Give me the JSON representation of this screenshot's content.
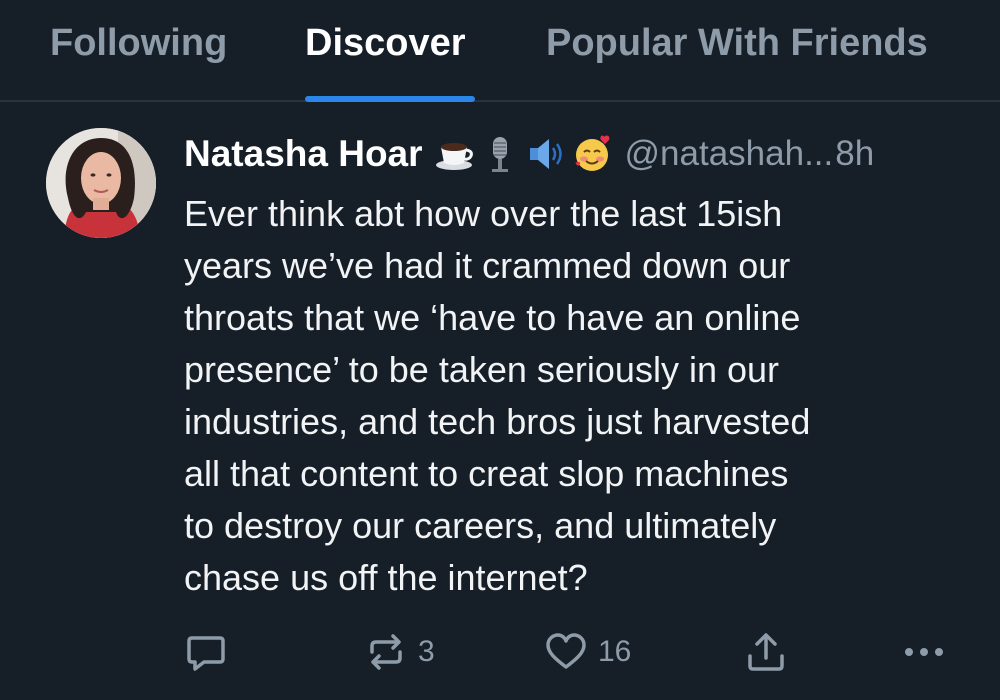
{
  "tabs": [
    {
      "label": "Following",
      "active": false
    },
    {
      "label": "Discover",
      "active": true
    },
    {
      "label": "Popular With Friends",
      "active": false
    }
  ],
  "accent_color": "#2a86e8",
  "post": {
    "author": {
      "name": "Natasha Hoar",
      "name_emojis": [
        "coffee-cup-icon",
        "microphone-icon",
        "speaker-icon",
        "smiling-face-with-hearts-icon"
      ],
      "handle": "@natashah...",
      "time": "8h"
    },
    "text_lines": [
      "Ever think abt how over the last 15ish",
      "years we’ve had it crammed down our",
      "throats that we ‘have to have an online",
      "presence’ to be taken seriously in our",
      "industries, and tech bros just harvested",
      "all that content to creat slop machines",
      "to destroy our careers, and ultimately",
      "chase us off the internet?"
    ],
    "actions": {
      "reply_count": "",
      "repost_count": "3",
      "like_count": "16"
    }
  }
}
